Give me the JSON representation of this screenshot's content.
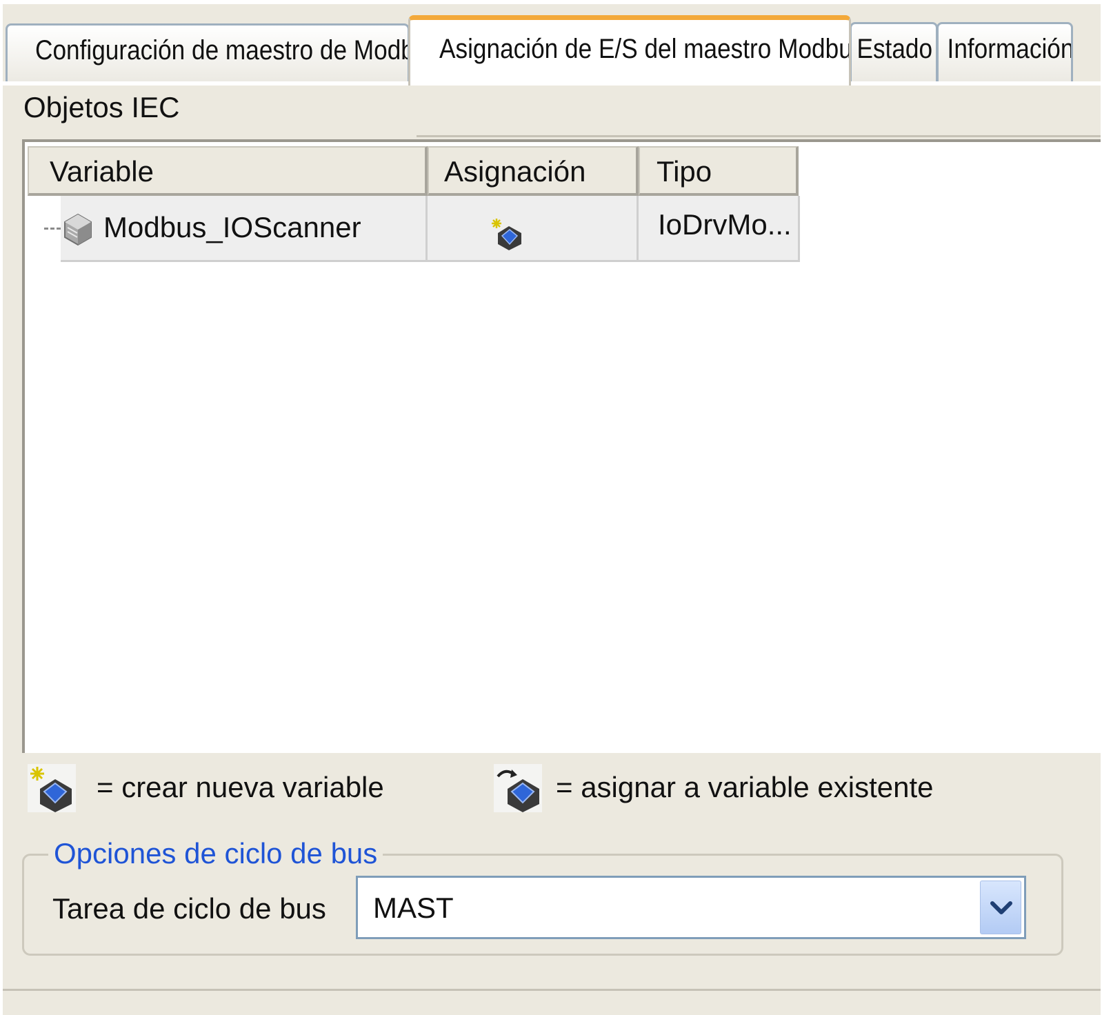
{
  "tabs": [
    {
      "label": "Configuración de maestro de Modbus",
      "active": false
    },
    {
      "label": "Asignación de E/S del maestro Modbus",
      "active": true
    },
    {
      "label": "Estado",
      "active": false
    },
    {
      "label": "Información",
      "active": false
    }
  ],
  "section": {
    "title": "Objetos IEC"
  },
  "table": {
    "columns": [
      "Variable",
      "Asignación",
      "Tipo"
    ],
    "rows": [
      {
        "variable": "Modbus_IOScanner",
        "mapping_icon": "create-new-variable-icon",
        "type": "IoDrvMo..."
      }
    ]
  },
  "legend": {
    "create_icon": "create-new-variable-icon",
    "create_label": "= crear nueva variable",
    "map_icon": "map-existing-variable-icon",
    "map_label": "= asignar a variable existente"
  },
  "bus_cycle": {
    "group_title": "Opciones de ciclo de bus",
    "task_label": "Tarea de ciclo de bus",
    "task_value": "MAST"
  },
  "colors": {
    "active_tab_accent": "#f3a93a",
    "group_title": "#1f54d6",
    "panel_background": "#ece9df"
  }
}
